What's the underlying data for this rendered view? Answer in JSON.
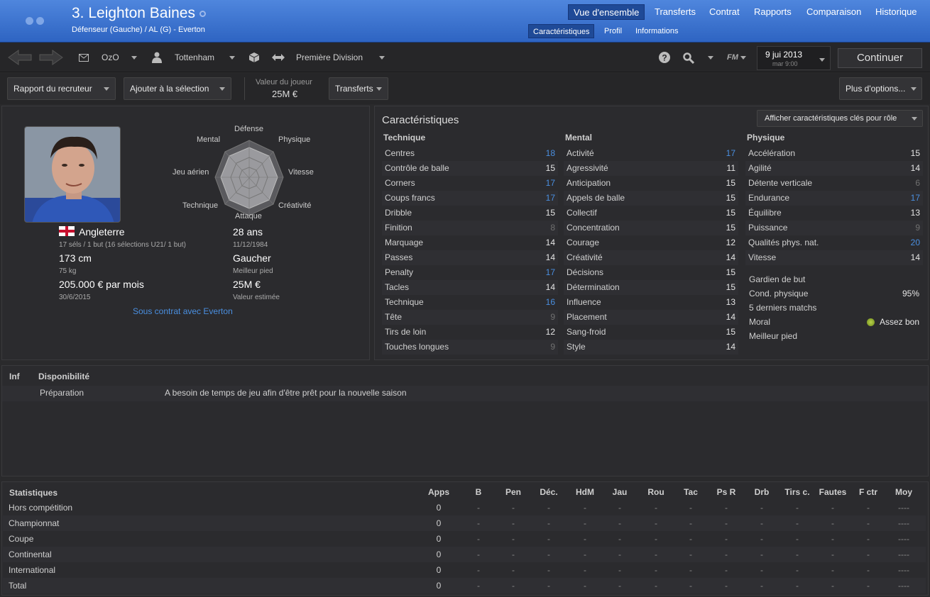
{
  "header": {
    "title": "3. Leighton Baines",
    "subtitle": "Défenseur (Gauche) / AL (G) - Everton",
    "tabs": [
      "Vue d'ensemble",
      "Transferts",
      "Contrat",
      "Rapports",
      "Comparaison",
      "Historique"
    ],
    "subtabs": [
      "Caractéristiques",
      "Profil",
      "Informations"
    ]
  },
  "toolbar": {
    "inbox": "OzO",
    "club": "Tottenham",
    "league": "Première Division",
    "date": "9 jui 2013",
    "time": "mar 9:00",
    "continue": "Continuer",
    "fm": "FM"
  },
  "actions": {
    "scout": "Rapport du recruteur",
    "shortlist": "Ajouter à la sélection",
    "value_label": "Valeur du joueur",
    "value": "25M €",
    "transfers": "Transferts",
    "more": "Plus d'options..."
  },
  "profile": {
    "nation": "Angleterre",
    "caps": "17 séls / 1 but (16 sélections U21/ 1 but)",
    "height": "173 cm",
    "weight": "75 kg",
    "wage": "205.000 € par mois",
    "contract_end": "30/6/2015",
    "age": "28 ans",
    "dob": "11/12/1984",
    "foot": "Gaucher",
    "foot_label": "Meilleur pied",
    "est_value": "25M €",
    "est_label": "Valeur estimée",
    "contract": "Sous contrat avec Everton"
  },
  "radar": {
    "labels": [
      "Défense",
      "Physique",
      "Vitesse",
      "Créativité",
      "Attaque",
      "Technique",
      "Jeu aérien",
      "Mental"
    ]
  },
  "attributes": {
    "title": "Caractéristiques",
    "role_button": "Afficher caractéristiques clés pour rôle",
    "technique_title": "Technique",
    "mental_title": "Mental",
    "physique_title": "Physique",
    "technique": [
      [
        "Centres",
        "18"
      ],
      [
        "Contrôle de balle",
        "15"
      ],
      [
        "Corners",
        "17"
      ],
      [
        "Coups francs",
        "17"
      ],
      [
        "Dribble",
        "15"
      ],
      [
        "Finition",
        "8"
      ],
      [
        "Marquage",
        "14"
      ],
      [
        "Passes",
        "14"
      ],
      [
        "Penalty",
        "17"
      ],
      [
        "Tacles",
        "14"
      ],
      [
        "Technique",
        "16"
      ],
      [
        "Tête",
        "9"
      ],
      [
        "Tirs de loin",
        "12"
      ],
      [
        "Touches longues",
        "9"
      ]
    ],
    "mental": [
      [
        "Activité",
        "17"
      ],
      [
        "Agressivité",
        "11"
      ],
      [
        "Anticipation",
        "15"
      ],
      [
        "Appels de balle",
        "15"
      ],
      [
        "Collectif",
        "15"
      ],
      [
        "Concentration",
        "15"
      ],
      [
        "Courage",
        "12"
      ],
      [
        "Créativité",
        "14"
      ],
      [
        "Décisions",
        "15"
      ],
      [
        "Détermination",
        "15"
      ],
      [
        "Influence",
        "13"
      ],
      [
        "Placement",
        "14"
      ],
      [
        "Sang-froid",
        "15"
      ],
      [
        "Style",
        "14"
      ]
    ],
    "physique": [
      [
        "Accélération",
        "15"
      ],
      [
        "Agilité",
        "14"
      ],
      [
        "Détente verticale",
        "6"
      ],
      [
        "Endurance",
        "17"
      ],
      [
        "Équilibre",
        "13"
      ],
      [
        "Puissance",
        "9"
      ],
      [
        "Qualités phys. nat.",
        "20"
      ],
      [
        "Vitesse",
        "14"
      ]
    ],
    "extra": {
      "gk": "Gardien de but",
      "cond_label": "Cond. physique",
      "cond": "95%",
      "last5": "5 derniers matchs",
      "morale_label": "Moral",
      "morale": "Assez bon",
      "best_foot": "Meilleur pied"
    }
  },
  "availability": {
    "inf": "Inf",
    "title": "Disponibilité",
    "label": "Préparation",
    "text": "A besoin de temps de jeu afin d'être prêt pour la nouvelle saison"
  },
  "stats": {
    "title": "Statistiques",
    "columns": [
      "Apps",
      "B",
      "Pen",
      "Déc.",
      "HdM",
      "Jau",
      "Rou",
      "Tac",
      "Ps R",
      "Drb",
      "Tirs c.",
      "Fautes",
      "F ctr",
      "Moy"
    ],
    "rows": [
      {
        "label": "Hors compétition",
        "apps": "0"
      },
      {
        "label": "Championnat",
        "apps": "0"
      },
      {
        "label": "Coupe",
        "apps": "0"
      },
      {
        "label": "Continental",
        "apps": "0"
      },
      {
        "label": "International",
        "apps": "0"
      },
      {
        "label": "Total",
        "apps": "0"
      }
    ],
    "dash": "-",
    "avg": "----"
  }
}
